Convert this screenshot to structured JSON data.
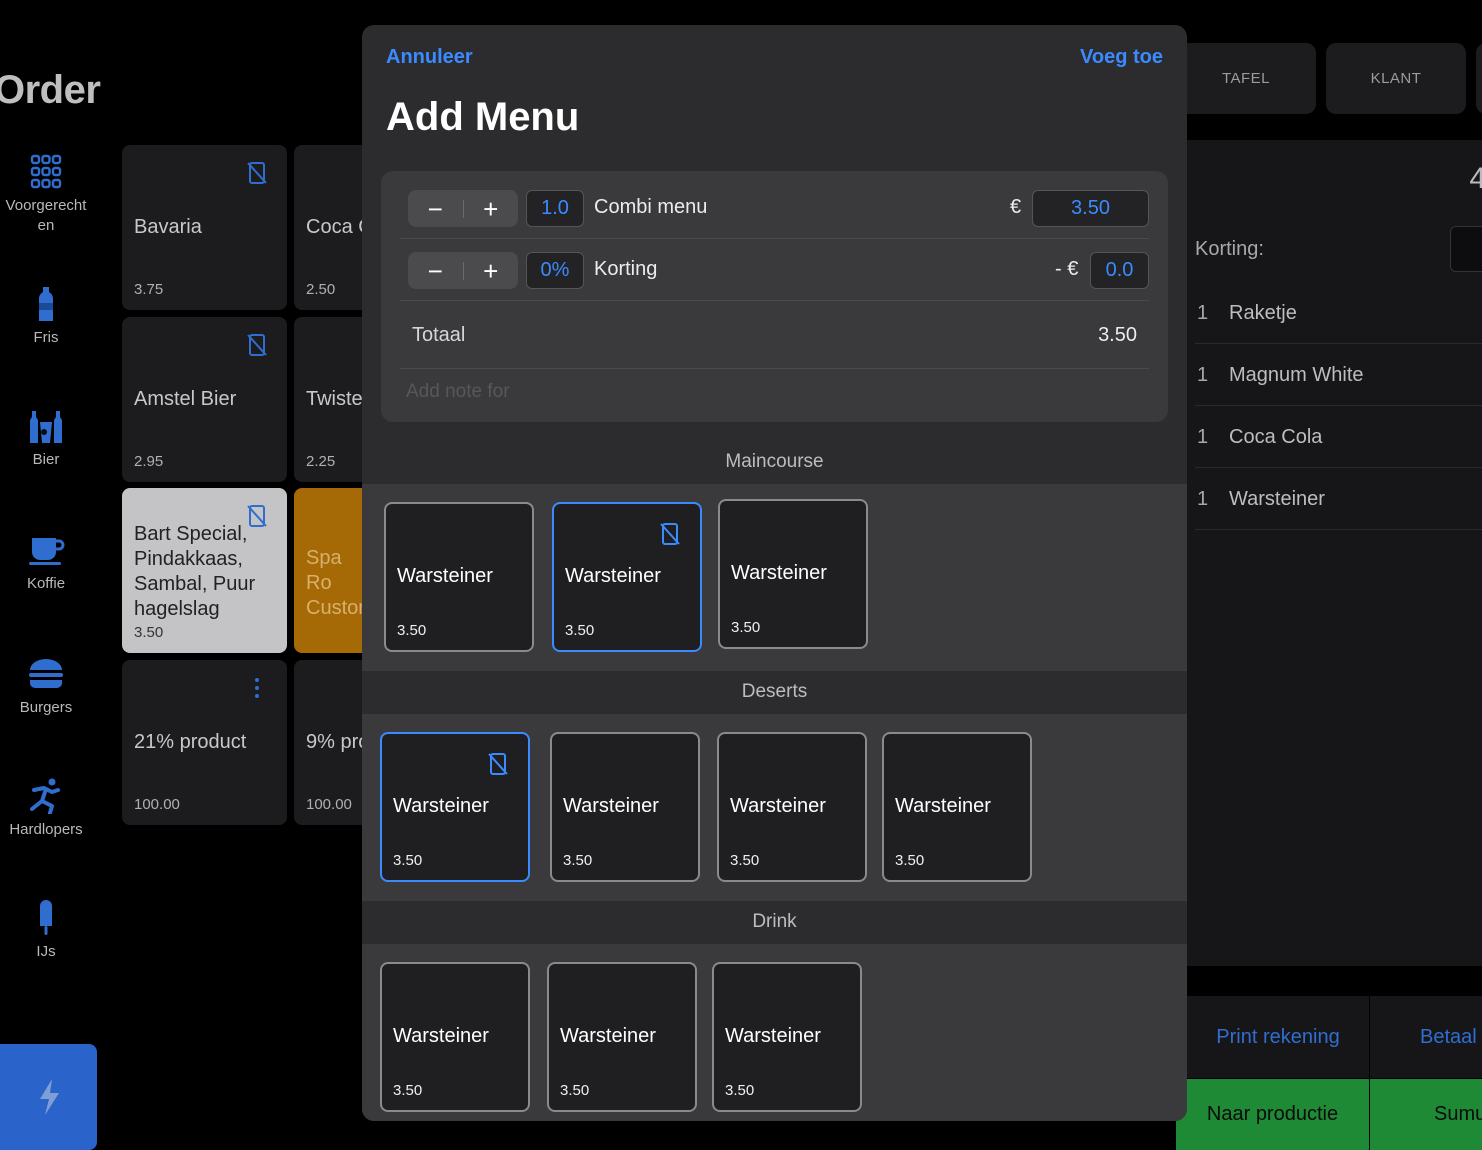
{
  "page": {
    "title": "Order"
  },
  "sidebar": {
    "items": [
      {
        "label": "Voorgerecht\nen",
        "icon": "grid-icon"
      },
      {
        "label": "Fris",
        "icon": "bottle-icon"
      },
      {
        "label": "Bier",
        "icon": "beer-icon"
      },
      {
        "label": "Koffie",
        "icon": "coffee-cup-icon"
      },
      {
        "label": "Burgers",
        "icon": "burger-icon"
      },
      {
        "label": "Hardlopers",
        "icon": "runner-icon"
      },
      {
        "label": "IJs",
        "icon": "popsicle-icon"
      }
    ],
    "quick_button_icon": "lightning-icon"
  },
  "products": [
    {
      "name": "Bavaria",
      "price": "3.75"
    },
    {
      "name": "Coca C",
      "price": "2.50"
    },
    {
      "name": "Amstel Bier",
      "price": "2.95"
    },
    {
      "name": "Twiste",
      "price": "2.25"
    },
    {
      "name": "Bart Special, Pindakkaas, Sambal, Puur hagelslag",
      "price": "3.50"
    },
    {
      "name": "Spa Ro Custor",
      "price": ""
    },
    {
      "name": "21% product",
      "price": "100.00"
    },
    {
      "name": "9% pro",
      "price": "100.00"
    }
  ],
  "top_tabs": [
    "TAFEL",
    "KLANT"
  ],
  "order": {
    "big_number": "4",
    "korting_label": "Korting:",
    "lines": [
      {
        "qty": "1",
        "name": "Raketje"
      },
      {
        "qty": "1",
        "name": "Magnum White"
      },
      {
        "qty": "1",
        "name": "Coca Cola"
      },
      {
        "qty": "1",
        "name": "Warsteiner"
      }
    ]
  },
  "actions": {
    "print": "Print rekening",
    "betaal": "Betaal",
    "productie": "Naar productie",
    "sumup": "Sumu"
  },
  "modal": {
    "cancel": "Annuleer",
    "add": "Voeg toe",
    "title": "Add Menu",
    "quantity": "1.0",
    "menu_name": "Combi menu",
    "currency": "€",
    "price": "3.50",
    "discount_percent": "0%",
    "discount_label": "Korting",
    "discount_currency": "- €",
    "discount_value": "0.0",
    "total_label": "Totaal",
    "total_value": "3.50",
    "note_placeholder": "Add note for",
    "stepper_minus": "−",
    "stepper_plus": "+",
    "sections": [
      {
        "title": "Maincourse",
        "items": [
          {
            "name": "Warsteiner",
            "price": "3.50",
            "selected": false
          },
          {
            "name": "Warsteiner",
            "price": "3.50",
            "selected": true
          },
          {
            "name": "Warsteiner",
            "price": "3.50",
            "selected": false
          }
        ]
      },
      {
        "title": "Deserts",
        "items": [
          {
            "name": "Warsteiner",
            "price": "3.50",
            "selected": true
          },
          {
            "name": "Warsteiner",
            "price": "3.50",
            "selected": false
          },
          {
            "name": "Warsteiner",
            "price": "3.50",
            "selected": false
          },
          {
            "name": "Warsteiner",
            "price": "3.50",
            "selected": false
          }
        ]
      },
      {
        "title": "Drink",
        "items": [
          {
            "name": "Warsteiner",
            "price": "3.50",
            "selected": false
          },
          {
            "name": "Warsteiner",
            "price": "3.50",
            "selected": false
          },
          {
            "name": "Warsteiner",
            "price": "3.50",
            "selected": false
          }
        ]
      }
    ]
  },
  "colors": {
    "accent": "#3a8bff",
    "confirm_green": "#1f8a36",
    "quick_blue": "#2a63c9",
    "warm_tile": "#a56a06"
  }
}
